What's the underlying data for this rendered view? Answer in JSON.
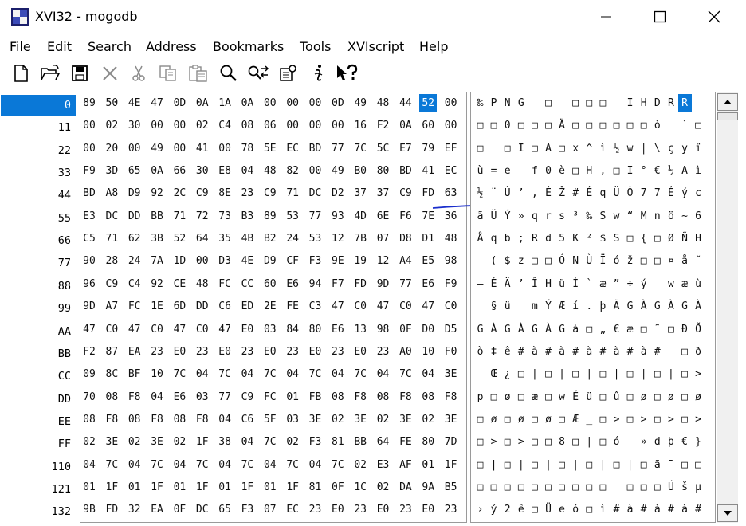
{
  "window": {
    "title": "XVI32 - mogodb",
    "controls": [
      "minimize",
      "maximize",
      "close"
    ]
  },
  "menu": [
    "File",
    "Edit",
    "Search",
    "Address",
    "Bookmarks",
    "Tools",
    "XVIscript",
    "Help"
  ],
  "toolbar": [
    "new-file-icon",
    "open-folder-icon",
    "save-disk-icon",
    "delete-x-icon",
    "cut-scissors-icon",
    "copy-icon",
    "paste-icon",
    "find-magnifier-icon",
    "find-replace-icon",
    "properties-icon",
    "tool-info-icon",
    "context-help-icon"
  ],
  "colors": {
    "selection": "#0a78d7",
    "annotation_underline": "#1a2ecc"
  },
  "rows": [
    {
      "addr": "0",
      "hex": [
        "89",
        "50",
        "4E",
        "47",
        "0D",
        "0A",
        "1A",
        "0A",
        "00",
        "00",
        "00",
        "0D",
        "49",
        "48",
        "44",
        "52",
        "00"
      ],
      "text": [
        "‰",
        "P",
        "N",
        "G",
        "",
        "□",
        "",
        "□",
        "□",
        "□",
        "",
        "I",
        "H",
        "D",
        "R",
        ""
      ]
    },
    {
      "addr": "11",
      "hex": [
        "00",
        "02",
        "30",
        "00",
        "00",
        "02",
        "C4",
        "08",
        "06",
        "00",
        "00",
        "00",
        "16",
        "F2",
        "0A",
        "60",
        "00"
      ],
      "text": [
        "□",
        "□",
        "0",
        "□",
        "□",
        "□",
        "Ä",
        "□",
        "□",
        "□",
        "□",
        "□",
        "□",
        "ò",
        "",
        "`",
        "□"
      ]
    },
    {
      "addr": "22",
      "hex": [
        "00",
        "20",
        "00",
        "49",
        "00",
        "41",
        "00",
        "78",
        "5E",
        "EC",
        "BD",
        "77",
        "7C",
        "5C",
        "E7",
        "79",
        "EF"
      ],
      "text": [
        "□",
        "",
        "□",
        "I",
        "□",
        "A",
        "□",
        "x",
        "^",
        "ì",
        "½",
        "w",
        "|",
        "\\",
        "ç",
        "y",
        "ï"
      ]
    },
    {
      "addr": "33",
      "hex": [
        "F9",
        "3D",
        "65",
        "0A",
        "66",
        "30",
        "E8",
        "04",
        "48",
        "82",
        "00",
        "49",
        "B0",
        "80",
        "BD",
        "41",
        "EC"
      ],
      "text": [
        "ù",
        "=",
        "e",
        "",
        "f",
        "0",
        "è",
        "□",
        "H",
        ",",
        "□",
        "I",
        "°",
        "€",
        "½",
        "A",
        "ì"
      ]
    },
    {
      "addr": "44",
      "hex": [
        "BD",
        "A8",
        "D9",
        "92",
        "2C",
        "C9",
        "8E",
        "23",
        "C9",
        "71",
        "DC",
        "D2",
        "37",
        "37",
        "C9",
        "FD",
        "63"
      ],
      "text": [
        "½",
        "¨",
        "Ù",
        "’",
        ",",
        "É",
        "Ž",
        "#",
        "É",
        "q",
        "Ü",
        "Ò",
        "7",
        "7",
        "É",
        "ý",
        "c"
      ]
    },
    {
      "addr": "55",
      "hex": [
        "E3",
        "DC",
        "DD",
        "BB",
        "71",
        "72",
        "73",
        "B3",
        "89",
        "53",
        "77",
        "93",
        "4D",
        "6E",
        "F6",
        "7E",
        "36"
      ],
      "text": [
        "ã",
        "Ü",
        "Ý",
        "»",
        "q",
        "r",
        "s",
        "³",
        "‰",
        "S",
        "w",
        "“",
        "M",
        "n",
        "ö",
        "~",
        "6"
      ]
    },
    {
      "addr": "66",
      "hex": [
        "C5",
        "71",
        "62",
        "3B",
        "52",
        "64",
        "35",
        "4B",
        "B2",
        "24",
        "53",
        "12",
        "7B",
        "07",
        "D8",
        "D1",
        "48"
      ],
      "text": [
        "Å",
        "q",
        "b",
        ";",
        "R",
        "d",
        "5",
        "K",
        "²",
        "$",
        "S",
        "□",
        "{",
        "□",
        "Ø",
        "Ñ",
        "H"
      ]
    },
    {
      "addr": "77",
      "hex": [
        "90",
        "28",
        "24",
        "7A",
        "1D",
        "00",
        "D3",
        "4E",
        "D9",
        "CF",
        "F3",
        "9E",
        "19",
        "12",
        "A4",
        "E5",
        "98"
      ],
      "text": [
        "",
        "(",
        "$",
        "z",
        "□",
        "□",
        "Ó",
        "N",
        "Ù",
        "Ï",
        "ó",
        "ž",
        "□",
        "□",
        "¤",
        "å",
        "˜"
      ]
    },
    {
      "addr": "88",
      "hex": [
        "96",
        "C9",
        "C4",
        "92",
        "CE",
        "48",
        "FC",
        "CC",
        "60",
        "E6",
        "94",
        "F7",
        "FD",
        "9D",
        "77",
        "E6",
        "F9"
      ],
      "text": [
        "–",
        "É",
        "Ä",
        "’",
        "Î",
        "H",
        "ü",
        "Ì",
        "`",
        "æ",
        "”",
        "÷",
        "ý",
        "",
        "w",
        "æ",
        "ù"
      ]
    },
    {
      "addr": "99",
      "hex": [
        "9D",
        "A7",
        "FC",
        "1E",
        "6D",
        "DD",
        "C6",
        "ED",
        "2E",
        "FE",
        "C3",
        "47",
        "C0",
        "47",
        "C0",
        "47",
        "C0"
      ],
      "text": [
        "",
        "§",
        "ü",
        "",
        "m",
        "Ý",
        "Æ",
        "í",
        ".",
        "þ",
        "Ã",
        "G",
        "À",
        "G",
        "À",
        "G",
        "À"
      ]
    },
    {
      "addr": "AA",
      "hex": [
        "47",
        "C0",
        "47",
        "C0",
        "47",
        "C0",
        "47",
        "E0",
        "03",
        "84",
        "80",
        "E6",
        "13",
        "98",
        "0F",
        "D0",
        "D5"
      ],
      "text": [
        "G",
        "À",
        "G",
        "À",
        "G",
        "À",
        "G",
        "à",
        "□",
        "„",
        "€",
        "æ",
        "□",
        "˜",
        "□",
        "Ð",
        "Õ"
      ]
    },
    {
      "addr": "BB",
      "hex": [
        "F2",
        "87",
        "EA",
        "23",
        "E0",
        "23",
        "E0",
        "23",
        "E0",
        "23",
        "E0",
        "23",
        "E0",
        "23",
        "A0",
        "10",
        "F0"
      ],
      "text": [
        "ò",
        "‡",
        "ê",
        "#",
        "à",
        "#",
        "à",
        "#",
        "à",
        "#",
        "à",
        "#",
        "à",
        "#",
        "",
        "□",
        "ð"
      ]
    },
    {
      "addr": "CC",
      "hex": [
        "09",
        "8C",
        "BF",
        "10",
        "7C",
        "04",
        "7C",
        "04",
        "7C",
        "04",
        "7C",
        "04",
        "7C",
        "04",
        "7C",
        "04",
        "3E"
      ],
      "text": [
        "",
        "Œ",
        "¿",
        "□",
        "|",
        "□",
        "|",
        "□",
        "|",
        "□",
        "|",
        "□",
        "|",
        "□",
        "|",
        "□",
        ">"
      ]
    },
    {
      "addr": "DD",
      "hex": [
        "70",
        "08",
        "F8",
        "04",
        "E6",
        "03",
        "77",
        "C9",
        "FC",
        "01",
        "FB",
        "08",
        "F8",
        "08",
        "F8",
        "08",
        "F8"
      ],
      "text": [
        "p",
        "□",
        "ø",
        "□",
        "æ",
        "□",
        "w",
        "É",
        "ü",
        "□",
        "û",
        "□",
        "ø",
        "□",
        "ø",
        "□",
        "ø"
      ]
    },
    {
      "addr": "EE",
      "hex": [
        "08",
        "F8",
        "08",
        "F8",
        "08",
        "F8",
        "04",
        "C6",
        "5F",
        "03",
        "3E",
        "02",
        "3E",
        "02",
        "3E",
        "02",
        "3E"
      ],
      "text": [
        "□",
        "ø",
        "□",
        "ø",
        "□",
        "ø",
        "□",
        "Æ",
        "_",
        "□",
        ">",
        "□",
        ">",
        "□",
        ">",
        "□",
        ">"
      ]
    },
    {
      "addr": "FF",
      "hex": [
        "02",
        "3E",
        "02",
        "3E",
        "02",
        "1F",
        "38",
        "04",
        "7C",
        "02",
        "F3",
        "81",
        "BB",
        "64",
        "FE",
        "80",
        "7D"
      ],
      "text": [
        "□",
        ">",
        "□",
        ">",
        "□",
        "□",
        "8",
        "□",
        "|",
        "□",
        "ó",
        "",
        "»",
        "d",
        "þ",
        "€",
        "}"
      ]
    },
    {
      "addr": "110",
      "hex": [
        "04",
        "7C",
        "04",
        "7C",
        "04",
        "7C",
        "04",
        "7C",
        "04",
        "7C",
        "04",
        "7C",
        "02",
        "E3",
        "AF",
        "01",
        "1F"
      ],
      "text": [
        "□",
        "|",
        "□",
        "|",
        "□",
        "|",
        "□",
        "|",
        "□",
        "|",
        "□",
        "|",
        "□",
        "ã",
        "¯",
        "□",
        "□"
      ]
    },
    {
      "addr": "121",
      "hex": [
        "01",
        "1F",
        "01",
        "1F",
        "01",
        "1F",
        "01",
        "1F",
        "01",
        "1F",
        "81",
        "0F",
        "1C",
        "02",
        "DA",
        "9A",
        "B5"
      ],
      "text": [
        "□",
        "□",
        "□",
        "□",
        "□",
        "□",
        "□",
        "□",
        "□",
        "□",
        "",
        "□",
        "□",
        "□",
        "Ú",
        "š",
        "µ"
      ]
    },
    {
      "addr": "132",
      "hex": [
        "9B",
        "FD",
        "32",
        "EA",
        "0F",
        "DC",
        "65",
        "F3",
        "07",
        "EC",
        "23",
        "E0",
        "23",
        "E0",
        "23",
        "E0",
        "23"
      ],
      "text": [
        "›",
        "ý",
        "2",
        "ê",
        "□",
        "Ü",
        "e",
        "ó",
        "□",
        "ì",
        "#",
        "à",
        "#",
        "à",
        "#",
        "à",
        "#"
      ]
    }
  ],
  "selection": {
    "row": 0,
    "col": 15,
    "value": "52",
    "char": "R"
  }
}
